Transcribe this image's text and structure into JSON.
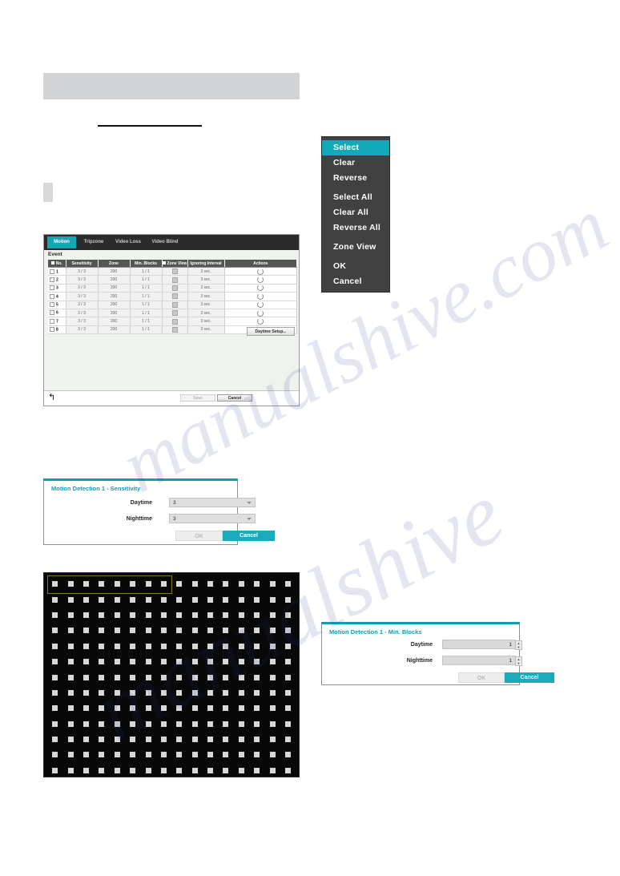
{
  "context_menu": {
    "items": [
      {
        "label": "Select",
        "selected": true,
        "gap_after": false
      },
      {
        "label": "Clear",
        "selected": false,
        "gap_after": false
      },
      {
        "label": "Reverse",
        "selected": false,
        "gap_after": true
      },
      {
        "label": "Select All",
        "selected": false,
        "gap_after": false
      },
      {
        "label": "Clear All",
        "selected": false,
        "gap_after": false
      },
      {
        "label": "Reverse All",
        "selected": false,
        "gap_after": true
      },
      {
        "label": "Zone View",
        "selected": false,
        "gap_after": true
      },
      {
        "label": "OK",
        "selected": false,
        "gap_after": false
      },
      {
        "label": "Cancel",
        "selected": false,
        "gap_after": false
      }
    ]
  },
  "setup_window": {
    "tabs": [
      {
        "label": "Motion",
        "active": true
      },
      {
        "label": "Tripzone",
        "active": false
      },
      {
        "label": "Video Loss",
        "active": false
      },
      {
        "label": "Video Blind",
        "active": false
      }
    ],
    "section_label": "Event",
    "table": {
      "headers": [
        "No.",
        "Sensitivity",
        "Zone",
        "Min. Blocks",
        "Zone View",
        "Ignoring Interval",
        "Actions"
      ],
      "rows": [
        {
          "no": "1",
          "sensitivity": "3 / 3",
          "zone": "200",
          "min_blocks": "1 / 1",
          "zone_view": "",
          "ignoring_interval": "3 sec.",
          "actions": ""
        },
        {
          "no": "2",
          "sensitivity": "3 / 3",
          "zone": "200",
          "min_blocks": "1 / 1",
          "zone_view": "",
          "ignoring_interval": "3 sec.",
          "actions": ""
        },
        {
          "no": "3",
          "sensitivity": "3 / 3",
          "zone": "200",
          "min_blocks": "1 / 1",
          "zone_view": "",
          "ignoring_interval": "3 sec.",
          "actions": ""
        },
        {
          "no": "4",
          "sensitivity": "3 / 3",
          "zone": "200",
          "min_blocks": "1 / 1",
          "zone_view": "",
          "ignoring_interval": "3 sec.",
          "actions": ""
        },
        {
          "no": "5",
          "sensitivity": "3 / 3",
          "zone": "200",
          "min_blocks": "1 / 1",
          "zone_view": "",
          "ignoring_interval": "3 sec.",
          "actions": ""
        },
        {
          "no": "6",
          "sensitivity": "3 / 3",
          "zone": "200",
          "min_blocks": "1 / 1",
          "zone_view": "",
          "ignoring_interval": "3 sec.",
          "actions": ""
        },
        {
          "no": "7",
          "sensitivity": "3 / 3",
          "zone": "200",
          "min_blocks": "1 / 1",
          "zone_view": "",
          "ignoring_interval": "3 sec.",
          "actions": ""
        },
        {
          "no": "8",
          "sensitivity": "3 / 3",
          "zone": "200",
          "min_blocks": "1 / 1",
          "zone_view": "",
          "ignoring_interval": "3 sec.",
          "actions": ""
        }
      ]
    },
    "daytime_setup_label": "Daytime Setup...",
    "footer": {
      "save_label": "Save",
      "cancel_label": "Cancel"
    }
  },
  "sensitivity_dialog": {
    "title": "Motion Detection 1 - Sensitivity",
    "daytime_label": "Daytime",
    "daytime_value": "3",
    "nighttime_label": "Nighttime",
    "nighttime_value": "3",
    "ok_label": "OK",
    "cancel_label": "Cancel"
  },
  "minblocks_dialog": {
    "title": "Motion Detection 1 - Min. Blocks",
    "daytime_label": "Daytime",
    "daytime_value": "1",
    "nighttime_label": "Nighttime",
    "nighttime_value": "1",
    "ok_label": "OK",
    "cancel_label": "Cancel"
  },
  "zone_grid": {
    "columns": 16,
    "rows": 13,
    "selection_columns": 8,
    "selection_row": 1
  },
  "watermark": {
    "line1": "manualshive.com",
    "line2": "manualshive"
  },
  "colors": {
    "accent_teal": "#19aabb",
    "menu_background": "#414141",
    "tab_bar": "#2b2b2b",
    "grid_background": "#080808",
    "selection_border": "#7d7a2a"
  }
}
